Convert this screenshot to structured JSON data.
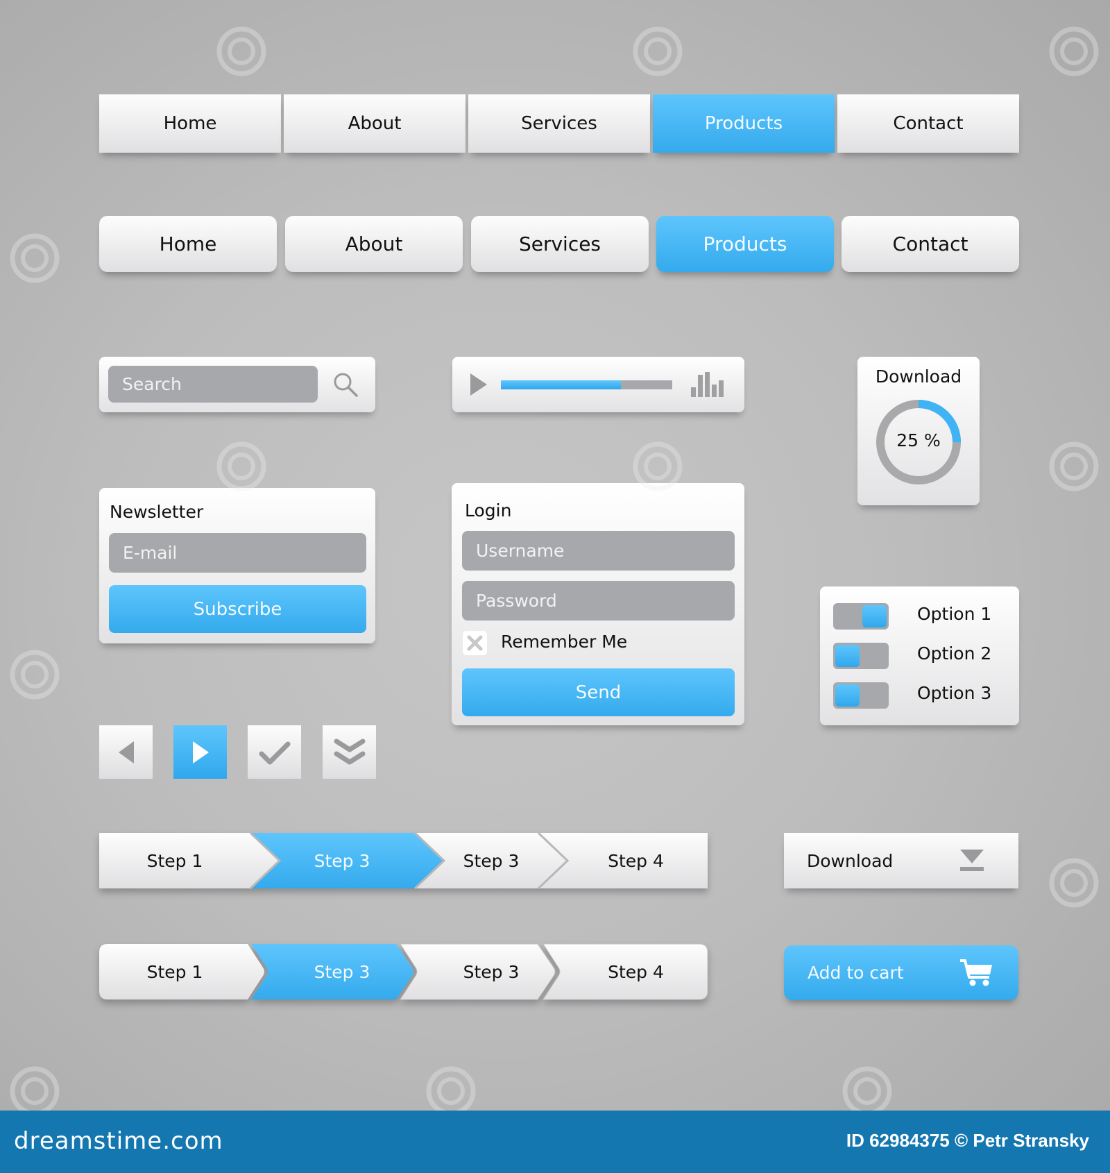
{
  "nav_flat": {
    "items": [
      {
        "label": "Home",
        "active": false
      },
      {
        "label": "About",
        "active": false
      },
      {
        "label": "Services",
        "active": false
      },
      {
        "label": "Products",
        "active": true
      },
      {
        "label": "Contact",
        "active": false
      }
    ]
  },
  "nav_rounded": {
    "items": [
      {
        "label": "Home",
        "active": false
      },
      {
        "label": "About",
        "active": false
      },
      {
        "label": "Services",
        "active": false
      },
      {
        "label": "Products",
        "active": true
      },
      {
        "label": "Contact",
        "active": false
      }
    ]
  },
  "search": {
    "placeholder": "Search",
    "icon": "search-icon"
  },
  "player": {
    "play_icon": "play-icon",
    "progress": 0.7,
    "equalizer_icon": "equalizer-icon"
  },
  "download_widget": {
    "title": "Download",
    "percent": 25,
    "percent_label": "25 %"
  },
  "newsletter": {
    "title": "Newsletter",
    "email_placeholder": "E-mail",
    "subscribe_label": "Subscribe"
  },
  "login": {
    "title": "Login",
    "username_placeholder": "Username",
    "password_placeholder": "Password",
    "remember_label": "Remember Me",
    "remember_checked": false,
    "send_label": "Send"
  },
  "options": [
    {
      "label": "Option 1",
      "on": true
    },
    {
      "label": "Option 2",
      "on": false
    },
    {
      "label": "Option 3",
      "on": false
    }
  ],
  "icon_buttons": [
    {
      "icon": "previous-icon",
      "active": false
    },
    {
      "icon": "play-icon",
      "active": true
    },
    {
      "icon": "checkmark-icon",
      "active": false
    },
    {
      "icon": "double-chevron-down-icon",
      "active": false
    }
  ],
  "steps_flat": {
    "items": [
      {
        "label": "Step 1",
        "active": false
      },
      {
        "label": "Step 3",
        "active": true
      },
      {
        "label": "Step 3",
        "active": false
      },
      {
        "label": "Step 4",
        "active": false
      }
    ]
  },
  "steps_rounded": {
    "items": [
      {
        "label": "Step 1",
        "active": false
      },
      {
        "label": "Step 3",
        "active": true
      },
      {
        "label": "Step 3",
        "active": false
      },
      {
        "label": "Step 4",
        "active": false
      }
    ]
  },
  "download_button": {
    "label": "Download",
    "icon": "download-icon"
  },
  "cart_button": {
    "label": "Add to cart",
    "icon": "cart-icon"
  },
  "footer": {
    "brand": "dreamstime.com",
    "credit": "ID 62984375 © Petr Stransky"
  },
  "colors": {
    "accent": "#3fb3f3",
    "background": "#bdbdbd",
    "field": "#a7a8ab",
    "footer": "#1477b0"
  }
}
